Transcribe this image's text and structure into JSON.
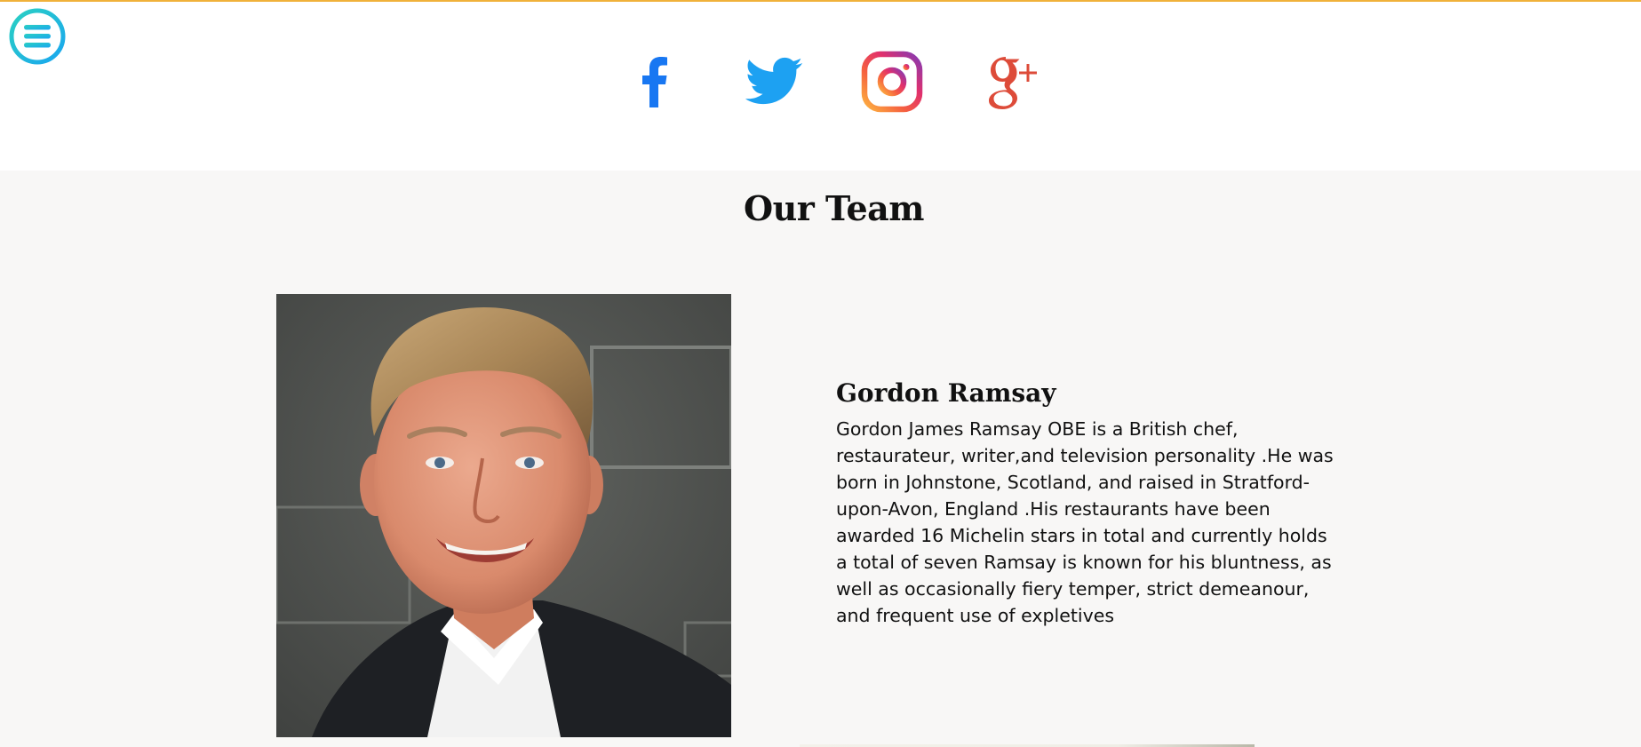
{
  "header": {
    "menu_icon": "hamburger-menu-icon",
    "accent_color": "#f0b13a",
    "menu_gradient": [
      "#2ad0c2",
      "#1aa6f0"
    ]
  },
  "social": [
    {
      "name": "facebook",
      "icon": "facebook-icon",
      "color": "#1877f2"
    },
    {
      "name": "twitter",
      "icon": "twitter-icon",
      "color": "#1da1f2"
    },
    {
      "name": "instagram",
      "icon": "instagram-icon",
      "color": "#e1306c"
    },
    {
      "name": "google-plus",
      "icon": "google-plus-icon",
      "color": "#dd4b39"
    }
  ],
  "team": {
    "title": "Our Team",
    "background": "#f8f7f6",
    "members": [
      {
        "name": "Gordon Ramsay",
        "photo": "chef-portrait",
        "bio": "Gordon James Ramsay OBE is a British chef, restaurateur, writer,and television personality .He was born in Johnstone, Scotland, and raised in Stratford-upon-Avon, England .His restaurants have been awarded 16 Michelin stars in total and currently holds a total of seven Ramsay is known for his bluntness, as well as occasionally fiery temper, strict demeanour, and frequent use of expletives"
      }
    ]
  }
}
